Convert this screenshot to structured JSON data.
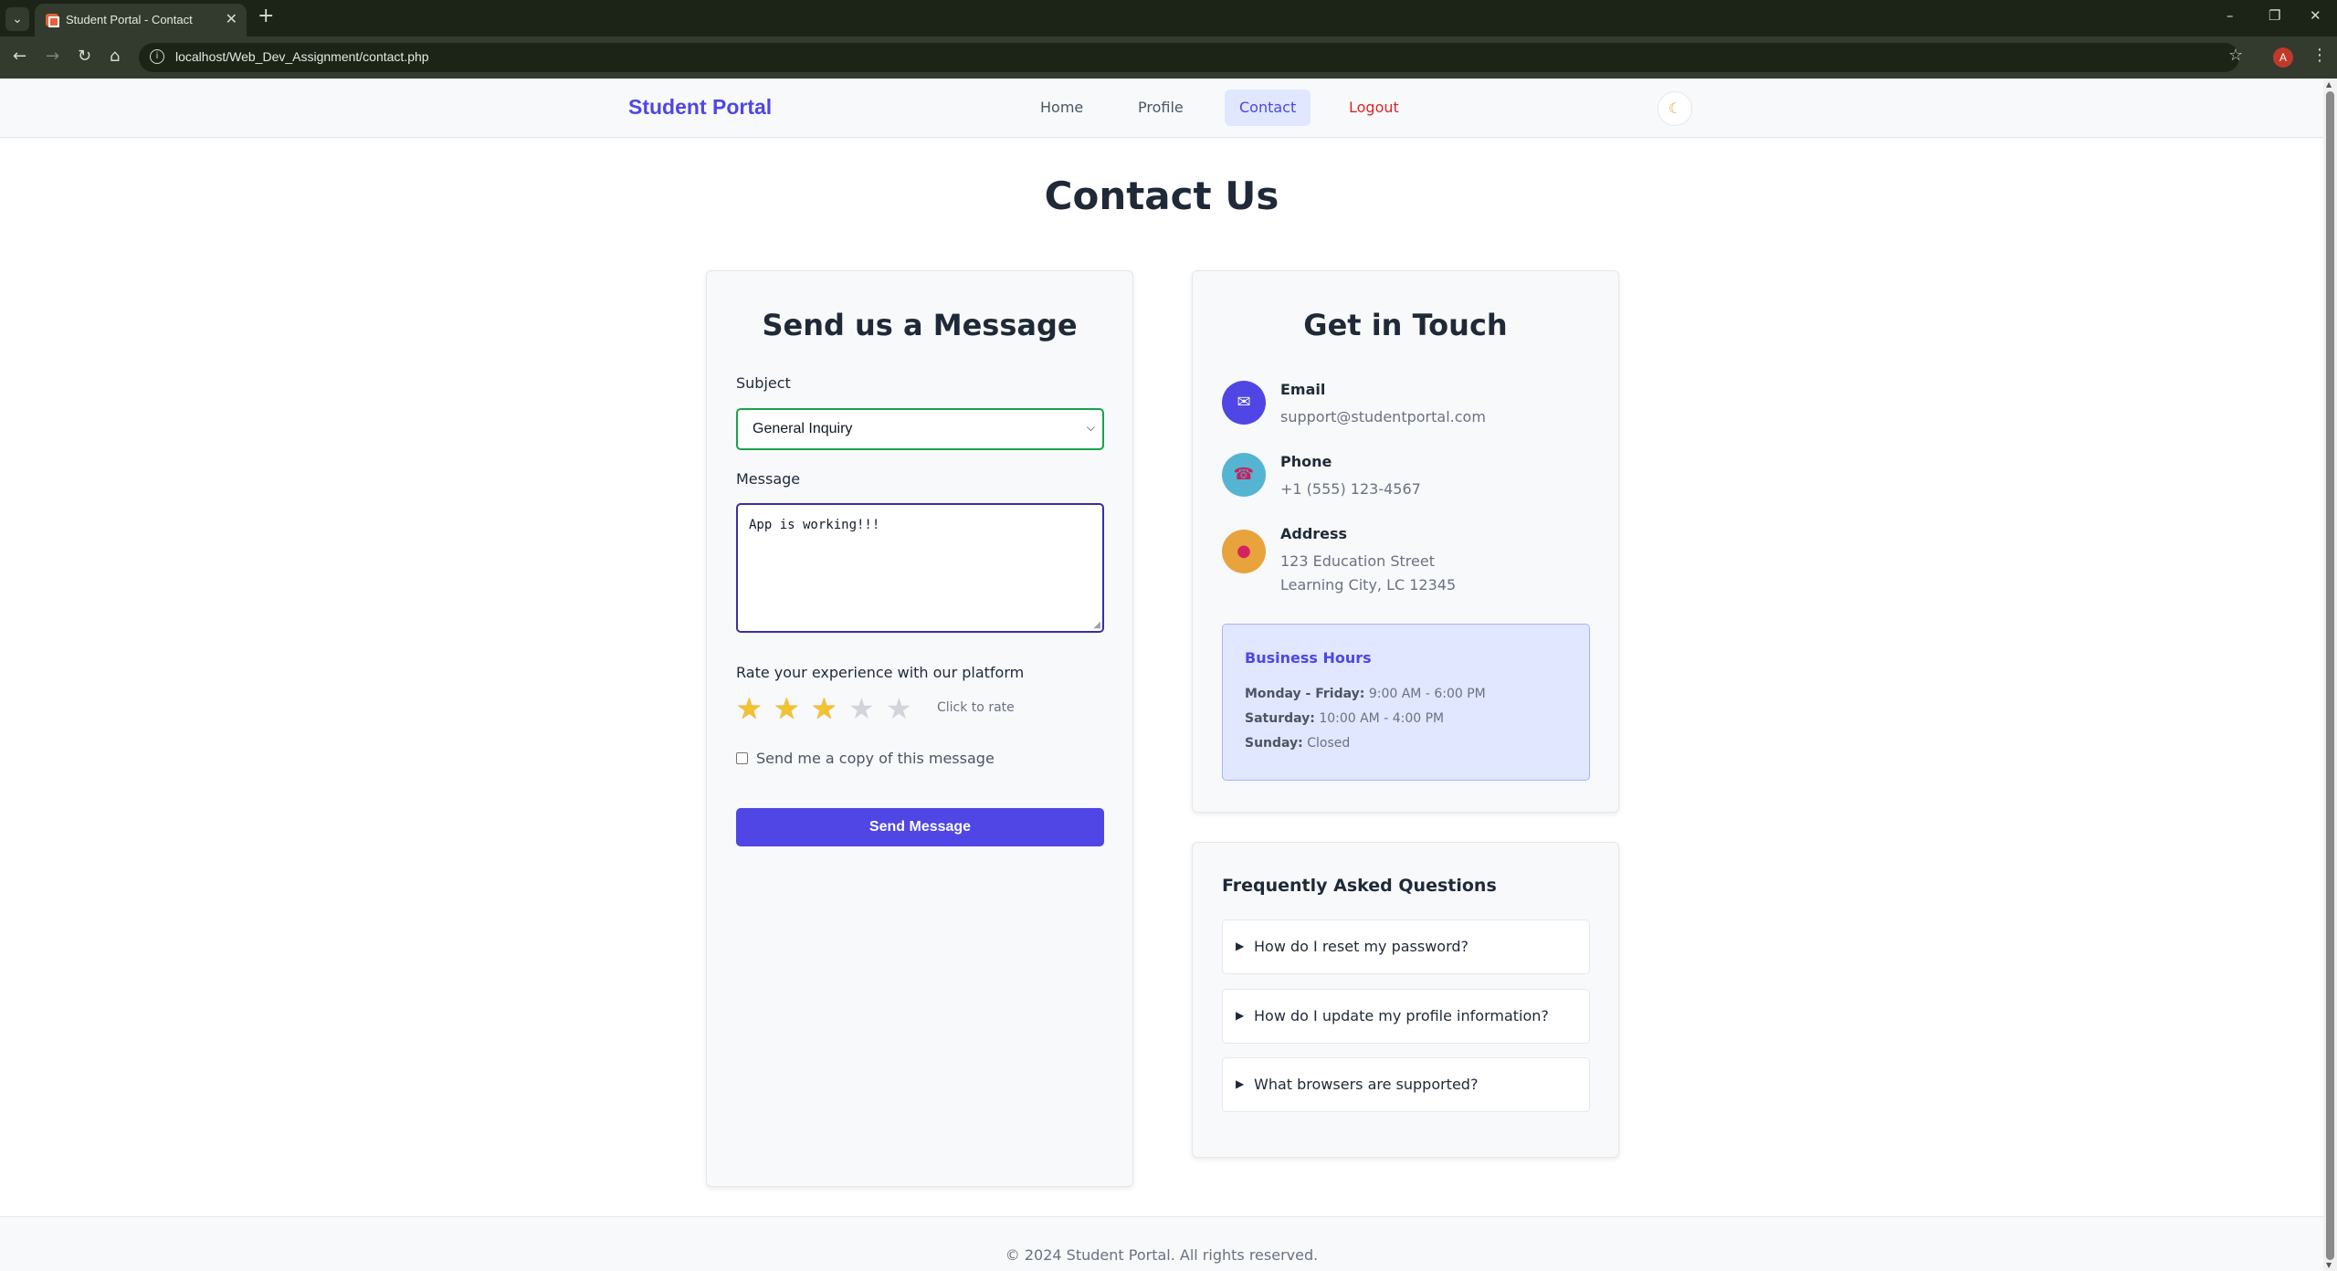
{
  "browser": {
    "tab_title": "Student Portal - Contact",
    "url": "localhost/Web_Dev_Assignment/contact.php",
    "profile_initial": "A"
  },
  "navbar": {
    "brand": "Student Portal",
    "links": [
      {
        "label": "Home"
      },
      {
        "label": "Profile"
      },
      {
        "label": "Contact"
      },
      {
        "label": "Logout"
      }
    ],
    "theme_icon": "moon-icon"
  },
  "page": {
    "title": "Contact Us"
  },
  "message_form": {
    "heading": "Send us a Message",
    "subject_label": "Subject",
    "subject_value": "General Inquiry",
    "message_label": "Message",
    "message_value": "App is working!!!",
    "rating_label": "Rate your experience with our platform",
    "rating": 3,
    "rating_max": 5,
    "rating_hint": "Click to rate",
    "copy_label": "Send me a copy of this message",
    "copy_checked": false,
    "submit_label": "Send Message"
  },
  "get_in_touch": {
    "heading": "Get in Touch",
    "email": {
      "title": "Email",
      "value": "support@studentportal.com",
      "icon": "envelope-icon",
      "color": "#4f46e5"
    },
    "phone": {
      "title": "Phone",
      "value": "+1 (555) 123-4567",
      "icon": "phone-icon",
      "color": "#56b4d3"
    },
    "address": {
      "title": "Address",
      "line1": "123 Education Street",
      "line2": "Learning City, LC 12345",
      "icon": "pin-icon",
      "color": "#e8a33d"
    },
    "hours": {
      "title": "Business Hours",
      "rows": [
        {
          "day": "Monday - Friday:",
          "time": "9:00 AM - 6:00 PM"
        },
        {
          "day": "Saturday:",
          "time": "10:00 AM - 4:00 PM"
        },
        {
          "day": "Sunday:",
          "time": "Closed"
        }
      ]
    }
  },
  "faq": {
    "title": "Frequently Asked Questions",
    "items": [
      {
        "q": "How do I reset my password?"
      },
      {
        "q": "How do I update my profile information?"
      },
      {
        "q": "What browsers are supported?"
      }
    ]
  },
  "footer": {
    "text": "© 2024 Student Portal. All rights reserved."
  },
  "colors": {
    "accent": "#4f46e5",
    "logout": "#dc2626",
    "star": "#f2c230"
  }
}
